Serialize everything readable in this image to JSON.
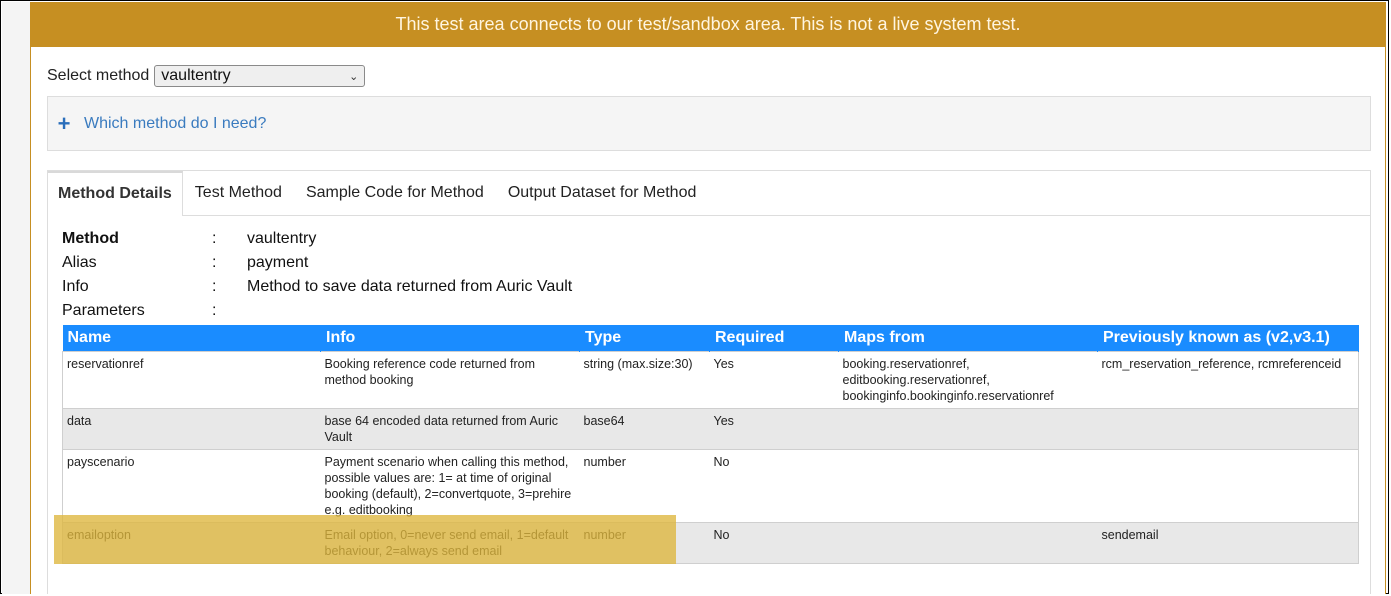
{
  "banner": {
    "text": "This test area connects to our test/sandbox area. This is not a live system test."
  },
  "selector": {
    "label": "Select method",
    "value": "vaultentry"
  },
  "accordion": {
    "label": "Which method do I need?"
  },
  "tabs": [
    "Method Details",
    "Test Method",
    "Sample Code for Method",
    "Output Dataset for Method"
  ],
  "meta": {
    "method_key": "Method",
    "method_val": "vaultentry",
    "alias_key": "Alias",
    "alias_val": "payment",
    "info_key": "Info",
    "info_val": "Method to save data returned from Auric Vault",
    "params_key": "Parameters",
    "sep": ":"
  },
  "table": {
    "headers": [
      "Name",
      "Info",
      "Type",
      "Required",
      "Maps from",
      "Previously known as (v2,v3.1)"
    ],
    "rows": [
      {
        "name": "reservationref",
        "info": "Booking reference code returned from method booking",
        "type": "string (max.size:30)",
        "required": "Yes",
        "maps_from": "booking.reservationref, editbooking.reservationref, bookinginfo.bookinginfo.reservationref",
        "previously": "rcm_reservation_reference, rcmreferenceid"
      },
      {
        "name": "data",
        "info": "base 64 encoded data returned from Auric Vault",
        "type": "base64",
        "required": "Yes",
        "maps_from": "",
        "previously": ""
      },
      {
        "name": "payscenario",
        "info": "Payment scenario when calling this method, possible values are: 1= at time of original booking (default), 2=convertquote, 3=prehire e.g. editbooking",
        "type": "number",
        "required": "No",
        "maps_from": "",
        "previously": ""
      },
      {
        "name": "emailoption",
        "info": "Email option, 0=never send email, 1=default behaviour, 2=always send email",
        "type": "number",
        "required": "No",
        "maps_from": "",
        "previously": "sendemail"
      }
    ]
  },
  "colors": {
    "banner": "#c68f22",
    "header": "#1a8cff",
    "highlight": "#deb63c",
    "link": "#3a7bbf"
  }
}
